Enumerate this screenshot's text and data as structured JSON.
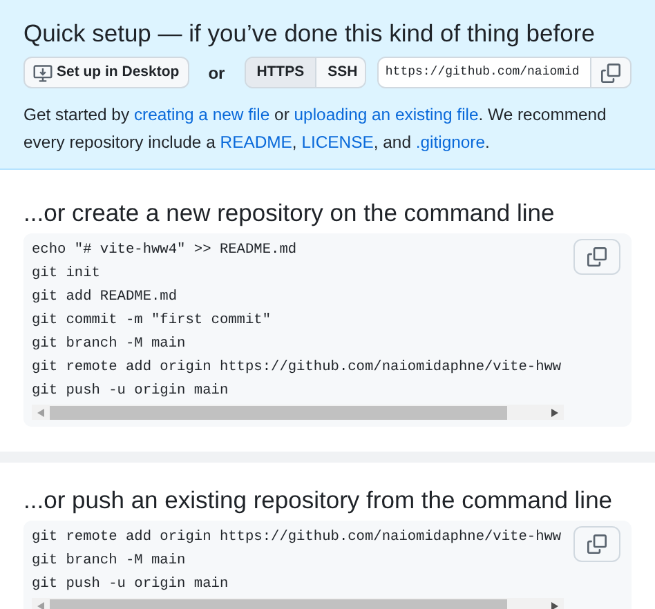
{
  "quick_setup": {
    "title": "Quick setup — if you’ve done this kind of thing before",
    "desktop_button": "Set up in Desktop",
    "or": "or",
    "protocols": [
      {
        "label": "HTTPS",
        "selected": true
      },
      {
        "label": "SSH",
        "selected": false
      }
    ],
    "url": "https://github.com/naiomid",
    "intro": [
      {
        "text": "Get started by ",
        "kind": "text"
      },
      {
        "text": "creating a new file",
        "kind": "link"
      },
      {
        "text": " or ",
        "kind": "text"
      },
      {
        "text": "uploading an existing file",
        "kind": "link"
      },
      {
        "text": ". We recommend every repository include a ",
        "kind": "text"
      },
      {
        "text": "README",
        "kind": "link"
      },
      {
        "text": ", ",
        "kind": "text"
      },
      {
        "text": "LICENSE",
        "kind": "link"
      },
      {
        "text": ", and ",
        "kind": "text"
      },
      {
        "text": ".gitignore",
        "kind": "link"
      },
      {
        "text": ".",
        "kind": "text"
      }
    ]
  },
  "sections": [
    {
      "title": "...or create a new repository on the command line",
      "lines": [
        "echo \"# vite-hww4\" >> README.md",
        "git init",
        "git add README.md",
        "git commit -m \"first commit\"",
        "git branch -M main",
        "git remote add origin https://github.com/naiomidaphne/vite-hww",
        "git push -u origin main"
      ]
    },
    {
      "title": "...or push an existing repository from the command line",
      "lines": [
        "git remote add origin https://github.com/naiomidaphne/vite-hww",
        "git branch -M main",
        "git push -u origin main"
      ]
    }
  ]
}
